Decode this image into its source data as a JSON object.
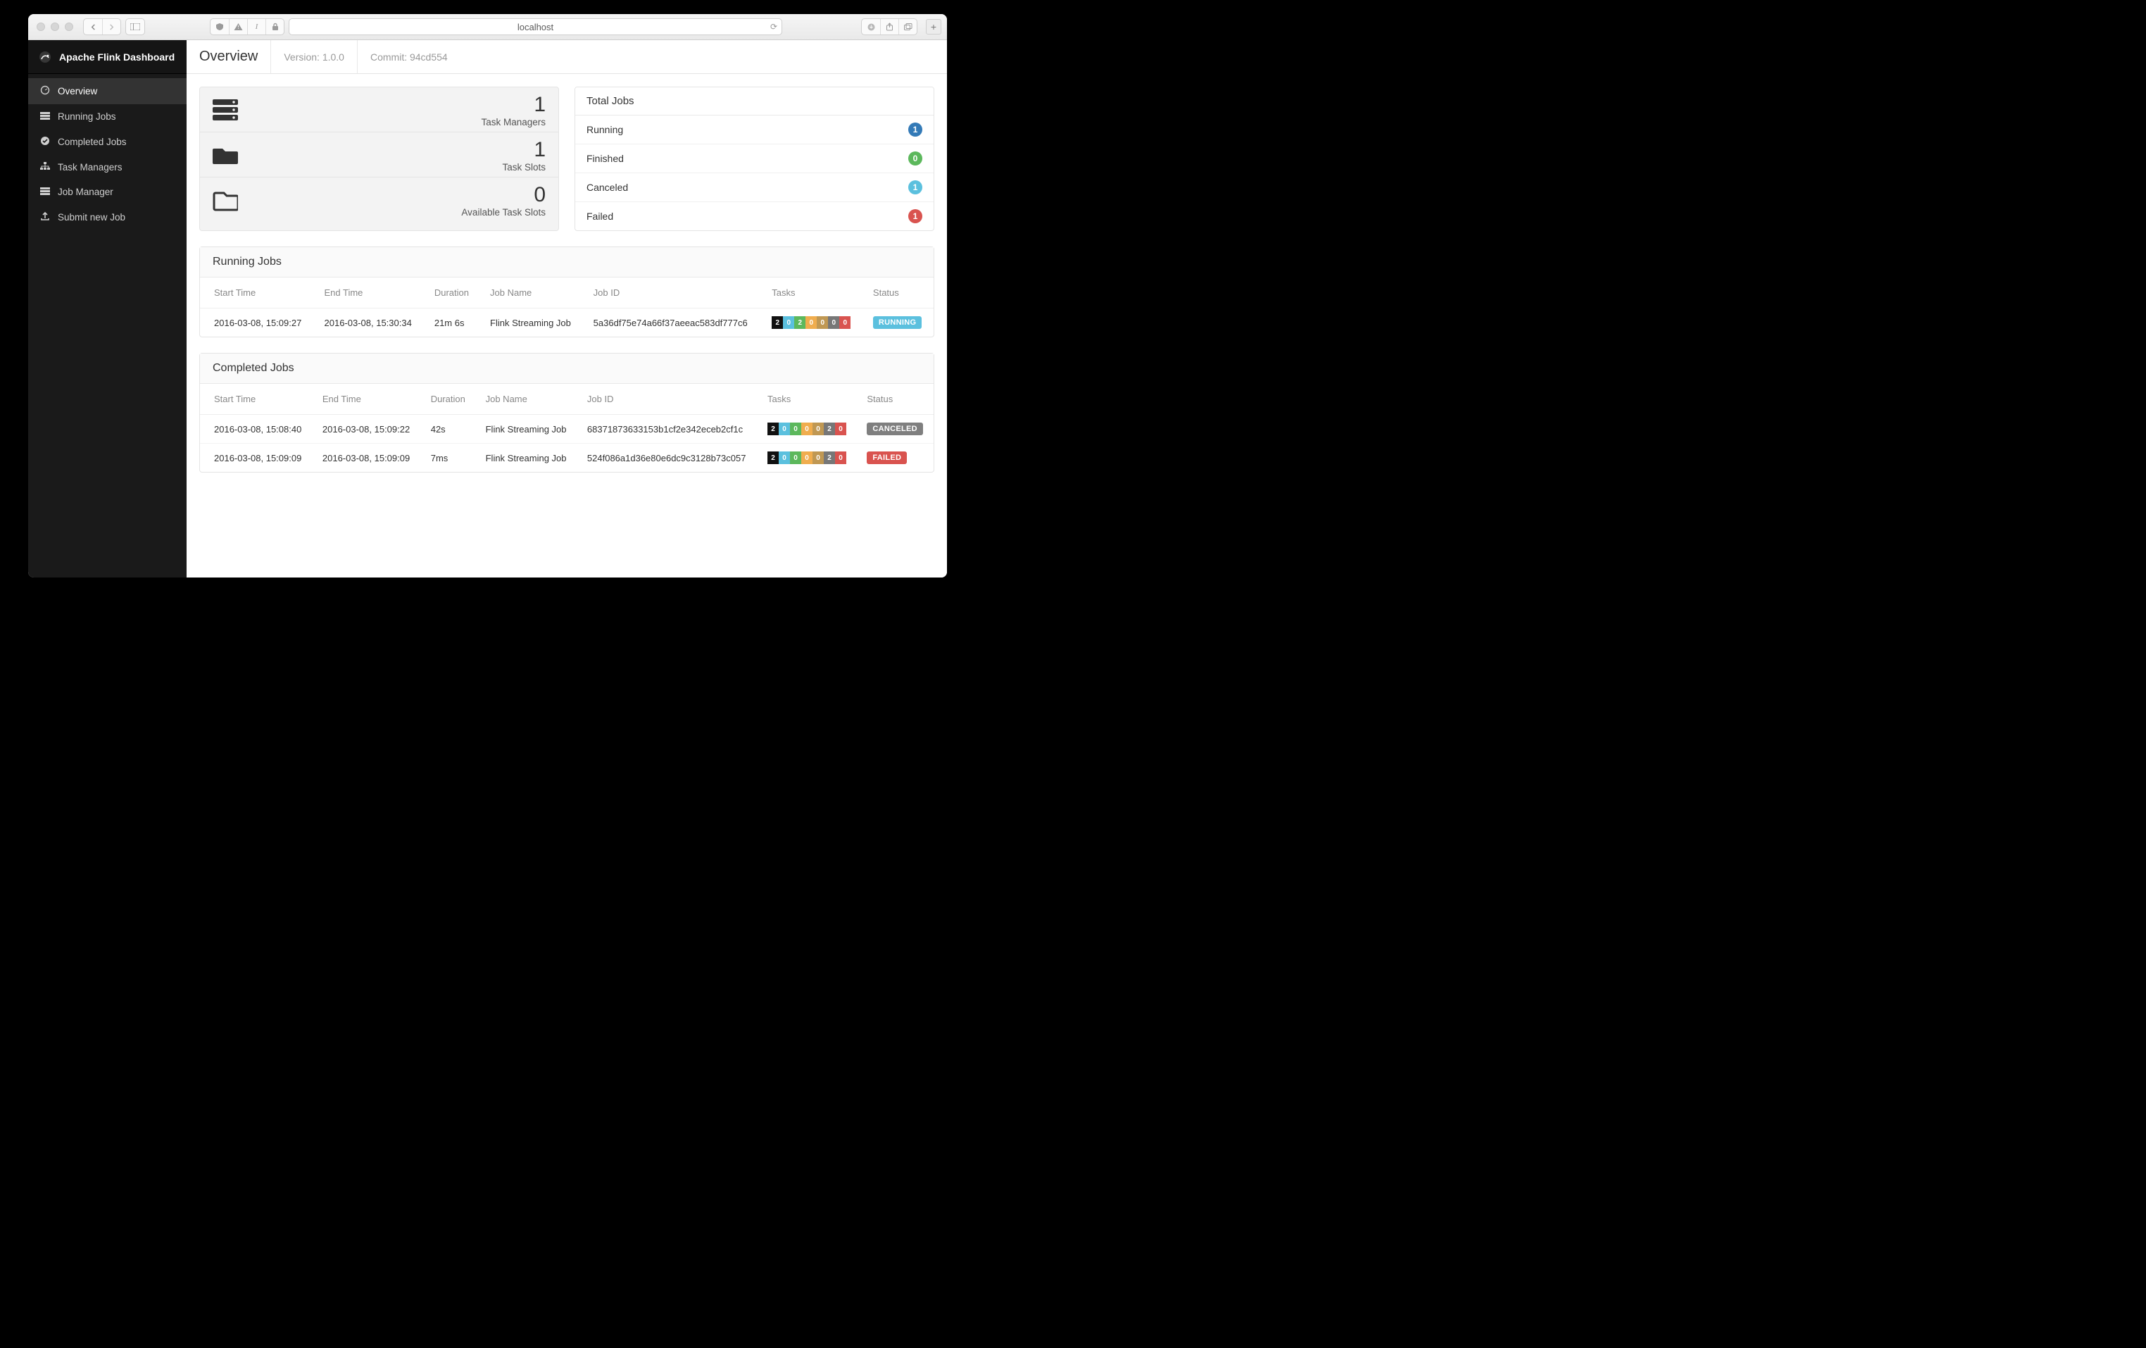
{
  "browser": {
    "url": "localhost"
  },
  "brand": "Apache Flink Dashboard",
  "topbar": {
    "title": "Overview",
    "version_label": "Version: 1.0.0",
    "commit_label": "Commit: 94cd554"
  },
  "sidebar": {
    "items": [
      {
        "label": "Overview"
      },
      {
        "label": "Running Jobs"
      },
      {
        "label": "Completed Jobs"
      },
      {
        "label": "Task Managers"
      },
      {
        "label": "Job Manager"
      },
      {
        "label": "Submit new Job"
      }
    ]
  },
  "stats": [
    {
      "value": "1",
      "label": "Task Managers"
    },
    {
      "value": "1",
      "label": "Task Slots"
    },
    {
      "value": "0",
      "label": "Available Task Slots"
    }
  ],
  "total_jobs": {
    "title": "Total Jobs",
    "rows": [
      {
        "label": "Running",
        "count": "1",
        "color": "b-blue"
      },
      {
        "label": "Finished",
        "count": "0",
        "color": "b-green"
      },
      {
        "label": "Canceled",
        "count": "1",
        "color": "b-cyan"
      },
      {
        "label": "Failed",
        "count": "1",
        "color": "b-red"
      }
    ]
  },
  "tables": {
    "columns": [
      "Start Time",
      "End Time",
      "Duration",
      "Job Name",
      "Job ID",
      "Tasks",
      "Status"
    ]
  },
  "running_jobs": {
    "title": "Running Jobs",
    "rows": [
      {
        "start": "2016-03-08, 15:09:27",
        "end": "2016-03-08, 15:30:34",
        "duration": "21m 6s",
        "name": "Flink Streaming Job",
        "id": "5a36df75e74a66f37aeeac583df777c6",
        "tasks": [
          "2",
          "0",
          "2",
          "0",
          "0",
          "0",
          "0"
        ],
        "status": "RUNNING",
        "status_class": "st-running"
      }
    ]
  },
  "completed_jobs": {
    "title": "Completed Jobs",
    "rows": [
      {
        "start": "2016-03-08, 15:08:40",
        "end": "2016-03-08, 15:09:22",
        "duration": "42s",
        "name": "Flink Streaming Job",
        "id": "68371873633153b1cf2e342eceb2cf1c",
        "tasks": [
          "2",
          "0",
          "0",
          "0",
          "0",
          "2",
          "0"
        ],
        "status": "CANCELED",
        "status_class": "st-canceled"
      },
      {
        "start": "2016-03-08, 15:09:09",
        "end": "2016-03-08, 15:09:09",
        "duration": "7ms",
        "name": "Flink Streaming Job",
        "id": "524f086a1d36e80e6dc9c3128b73c057",
        "tasks": [
          "2",
          "0",
          "0",
          "0",
          "0",
          "2",
          "0"
        ],
        "status": "FAILED",
        "status_class": "st-failed"
      }
    ]
  }
}
